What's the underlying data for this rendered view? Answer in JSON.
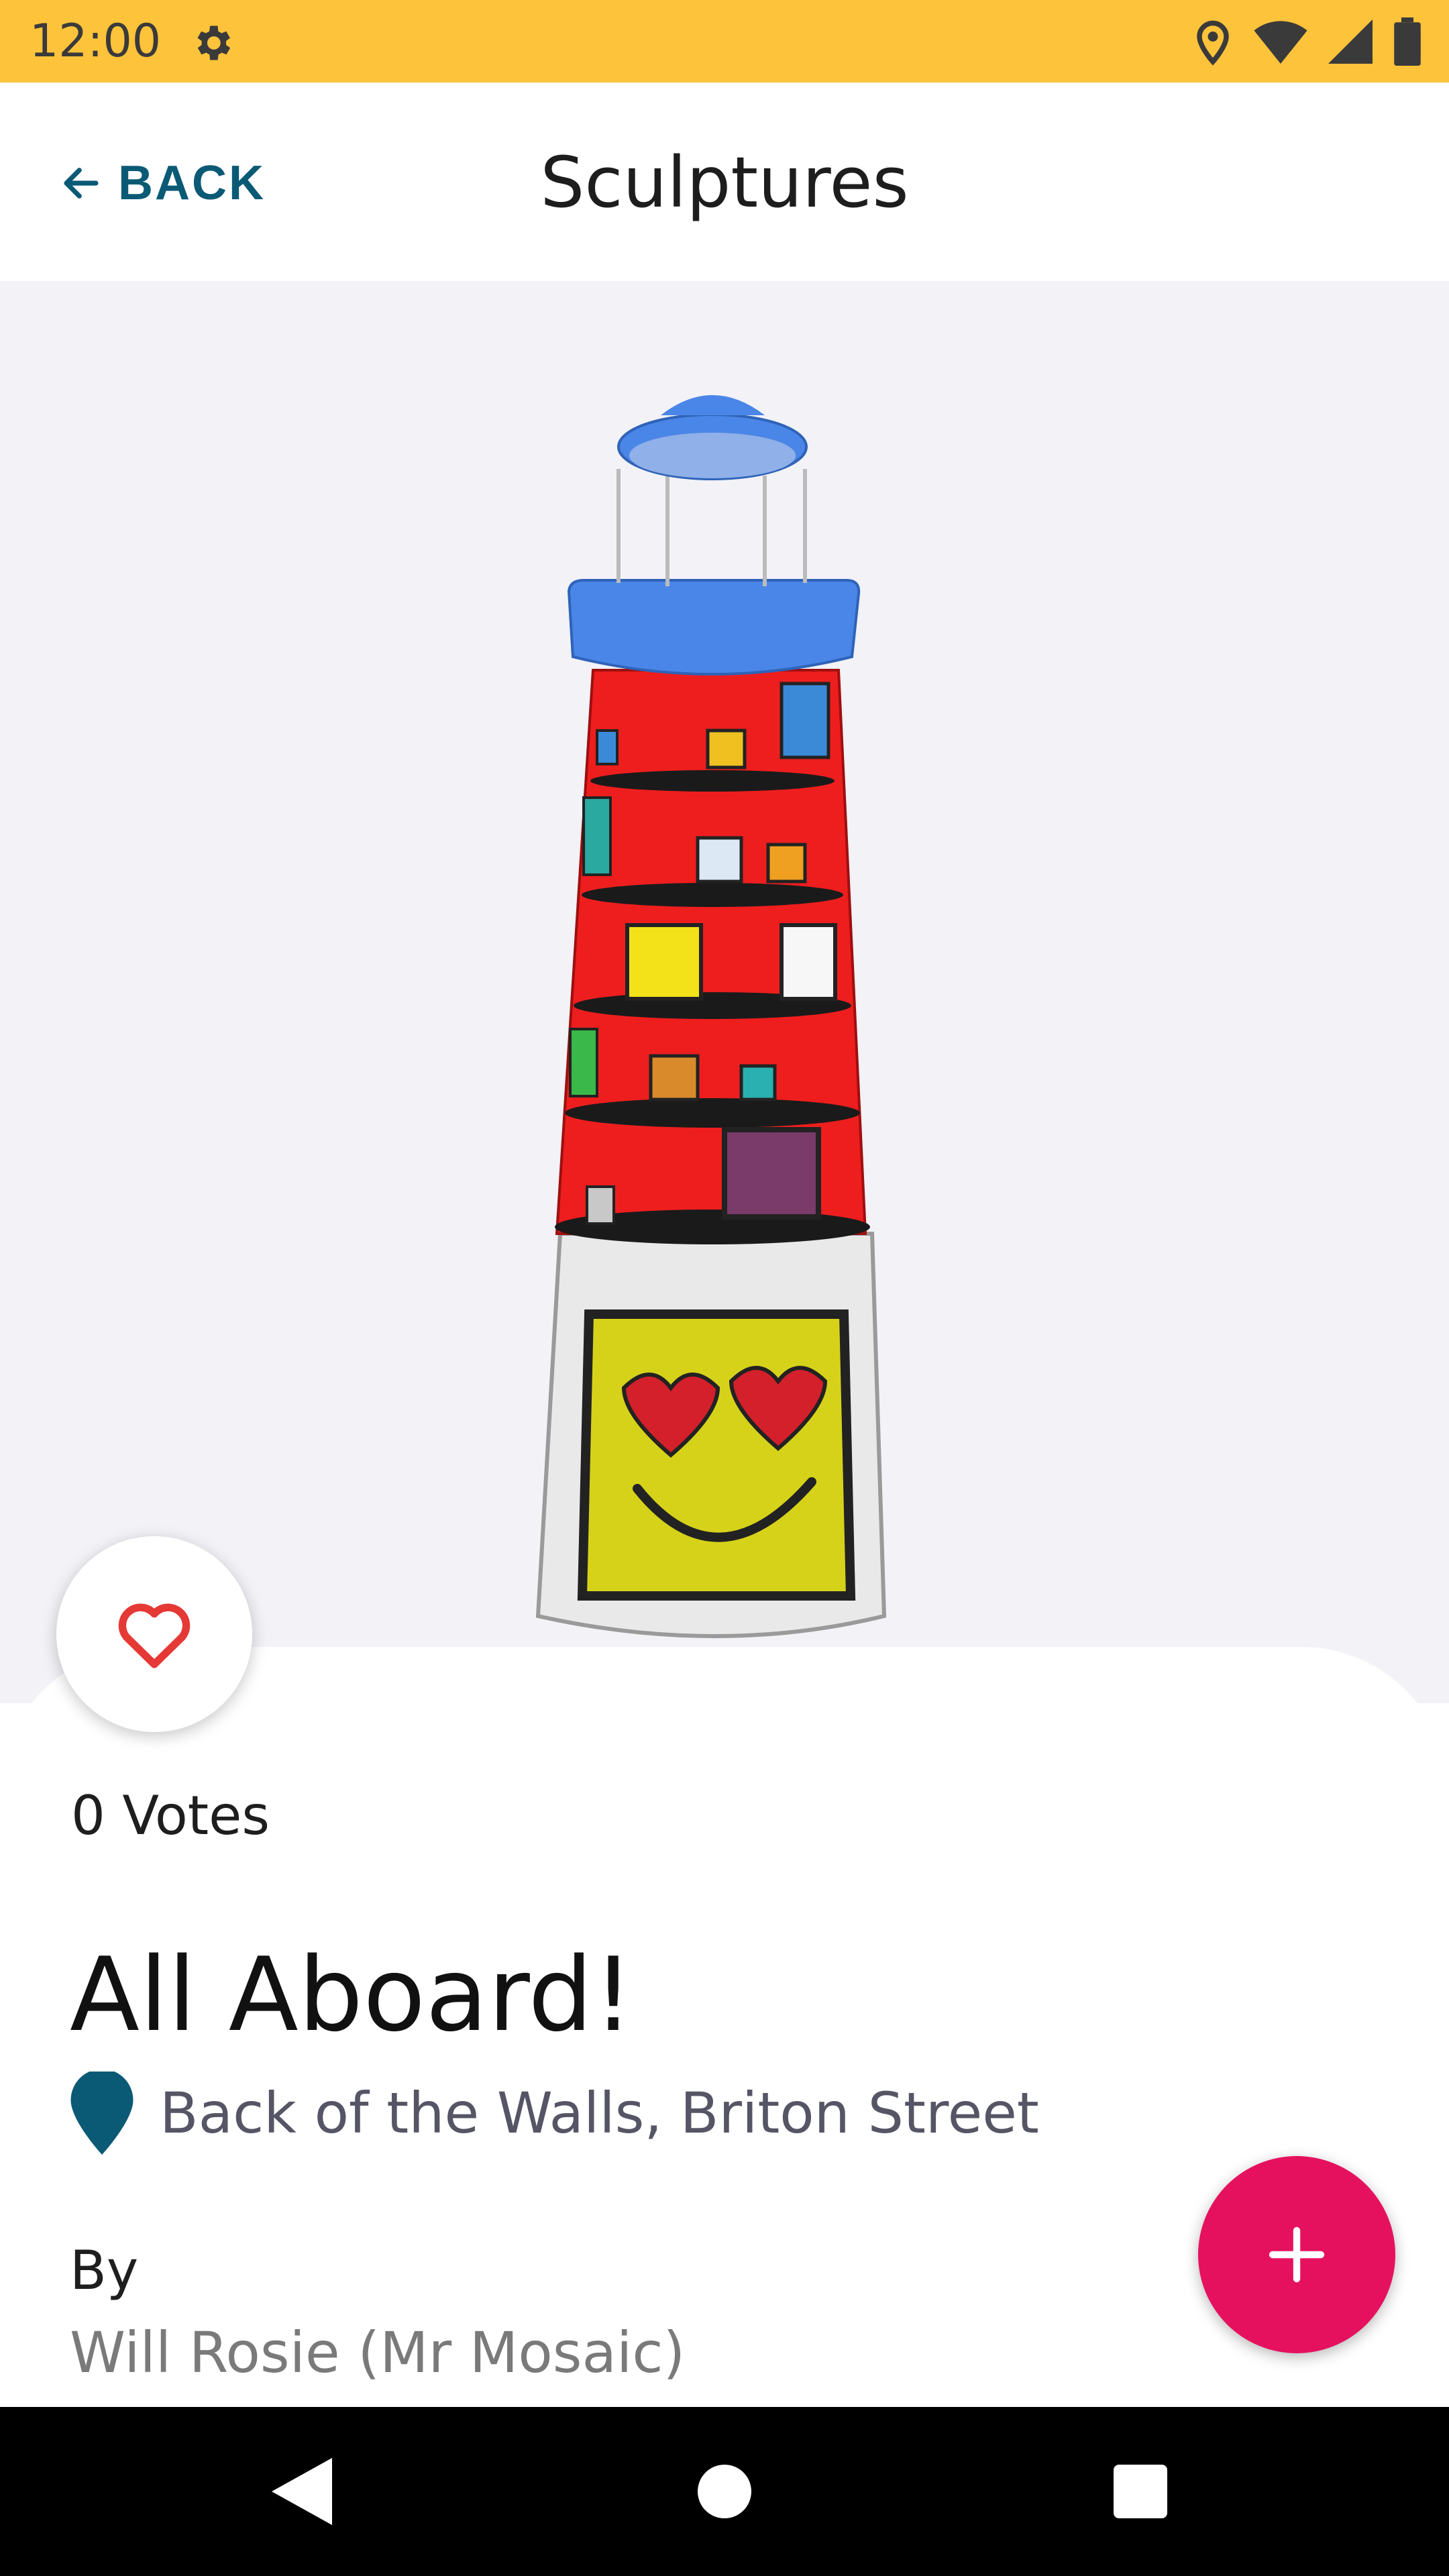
{
  "status_bar": {
    "time": "12:00",
    "icons": [
      "settings-icon",
      "location-icon",
      "wifi-icon",
      "signal-icon",
      "battery-icon"
    ]
  },
  "app_bar": {
    "back_label": "BACK",
    "title": "Sculptures"
  },
  "sculpture": {
    "votes_label": "0 Votes",
    "title": "All Aboard!",
    "location": "Back of the Walls, Briton Street",
    "by_label": "By",
    "artist": "Will Rosie (Mr Mosaic)"
  },
  "colors": {
    "status_bar": "#FDC33B",
    "accent": "#0B5A75",
    "fab": "#E5115F",
    "heart": "#E53935"
  }
}
